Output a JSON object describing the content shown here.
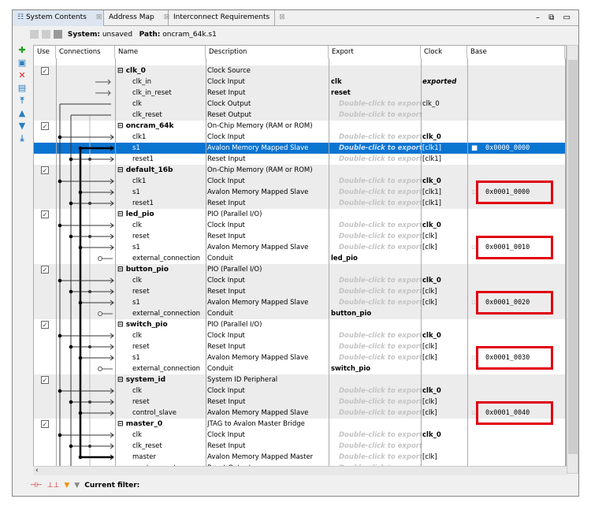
{
  "tabs": [
    {
      "label": "System Contents",
      "close": "⊠"
    },
    {
      "label": "Address Map",
      "close": "⊠"
    },
    {
      "label": "Interconnect Requirements",
      "close": "⊠"
    }
  ],
  "window_controls": "– ⧉ ▭",
  "pathbar": {
    "system_label": "System:",
    "system_value": "unsaved",
    "path_label": "Path:",
    "path_value": "oncram_64k.s1"
  },
  "columns": [
    "Use",
    "Connections",
    "Name",
    "Description",
    "Export",
    "Clock",
    "Base"
  ],
  "export_placeholder": "Double-click to export",
  "rows": [
    {
      "name": "clk_0",
      "desc": "Clock Source",
      "group": true,
      "checked": true
    },
    {
      "name": "clk_in",
      "desc": "Clock Input",
      "export": "clk",
      "clock": "exported"
    },
    {
      "name": "clk_in_reset",
      "desc": "Reset Input",
      "export": "reset"
    },
    {
      "name": "clk",
      "desc": "Clock Output",
      "dc": true,
      "clock": "clk_0"
    },
    {
      "name": "clk_reset",
      "desc": "Reset Output",
      "dc": true
    },
    {
      "name": "oncram_64k",
      "desc": "On-Chip Memory (RAM or ROM)",
      "group": true,
      "checked": true
    },
    {
      "name": "clk1",
      "desc": "Clock Input",
      "dc": true,
      "clock": "clk_0",
      "clockbold": true,
      "conn": "clk"
    },
    {
      "name": "s1",
      "desc": "Avalon Memory Mapped Slave",
      "dc": true,
      "clock": "[clk1]",
      "base": "0x0000_0000",
      "locked": true,
      "selected": true,
      "conn": "av"
    },
    {
      "name": "reset1",
      "desc": "Reset Input",
      "dc": true,
      "clock": "[clk1]",
      "conn": "rst"
    },
    {
      "name": "default_16b",
      "desc": "On-Chip Memory (RAM or ROM)",
      "group": true,
      "checked": true
    },
    {
      "name": "clk1",
      "desc": "Clock Input",
      "dc": true,
      "clock": "clk_0",
      "clockbold": true,
      "conn": "clk"
    },
    {
      "name": "s1",
      "desc": "Avalon Memory Mapped Slave",
      "dc": true,
      "clock": "[clk1]",
      "base": "0x0001_0000",
      "hl": true,
      "conn": "av"
    },
    {
      "name": "reset1",
      "desc": "Reset Input",
      "dc": true,
      "clock": "[clk1]",
      "conn": "rst"
    },
    {
      "name": "led_pio",
      "desc": "PIO (Parallel I/O)",
      "group": true,
      "checked": true
    },
    {
      "name": "clk",
      "desc": "Clock Input",
      "dc": true,
      "clock": "clk_0",
      "clockbold": true,
      "conn": "clk"
    },
    {
      "name": "reset",
      "desc": "Reset Input",
      "dc": true,
      "clock": "[clk]",
      "conn": "rst"
    },
    {
      "name": "s1",
      "desc": "Avalon Memory Mapped Slave",
      "dc": true,
      "clock": "[clk]",
      "base": "0x0001_0010",
      "hl": true,
      "conn": "av"
    },
    {
      "name": "external_connection",
      "desc": "Conduit",
      "export": "led_pio",
      "conn": "cd"
    },
    {
      "name": "button_pio",
      "desc": "PIO (Parallel I/O)",
      "group": true,
      "checked": true
    },
    {
      "name": "clk",
      "desc": "Clock Input",
      "dc": true,
      "clock": "clk_0",
      "clockbold": true,
      "conn": "clk"
    },
    {
      "name": "reset",
      "desc": "Reset Input",
      "dc": true,
      "clock": "[clk]",
      "conn": "rst"
    },
    {
      "name": "s1",
      "desc": "Avalon Memory Mapped Slave",
      "dc": true,
      "clock": "[clk]",
      "base": "0x0001_0020",
      "hl": true,
      "conn": "av"
    },
    {
      "name": "external_connection",
      "desc": "Conduit",
      "export": "button_pio",
      "conn": "cd"
    },
    {
      "name": "switch_pio",
      "desc": "PIO (Parallel I/O)",
      "group": true,
      "checked": true
    },
    {
      "name": "clk",
      "desc": "Clock Input",
      "dc": true,
      "clock": "clk_0",
      "clockbold": true,
      "conn": "clk"
    },
    {
      "name": "reset",
      "desc": "Reset Input",
      "dc": true,
      "clock": "[clk]",
      "conn": "rst"
    },
    {
      "name": "s1",
      "desc": "Avalon Memory Mapped Slave",
      "dc": true,
      "clock": "[clk]",
      "base": "0x0001_0030",
      "hl": true,
      "conn": "av"
    },
    {
      "name": "external_connection",
      "desc": "Conduit",
      "export": "switch_pio",
      "conn": "cd"
    },
    {
      "name": "system_id",
      "desc": "System ID Peripheral",
      "group": true,
      "checked": true
    },
    {
      "name": "clk",
      "desc": "Clock Input",
      "dc": true,
      "clock": "clk_0",
      "clockbold": true,
      "conn": "clk"
    },
    {
      "name": "reset",
      "desc": "Reset Input",
      "dc": true,
      "clock": "[clk]",
      "conn": "rst"
    },
    {
      "name": "control_slave",
      "desc": "Avalon Memory Mapped Slave",
      "dc": true,
      "clock": "[clk]",
      "base": "0x0001_0040",
      "hl": true,
      "conn": "av"
    },
    {
      "name": "master_0",
      "desc": "JTAG to Avalon Master Bridge",
      "group": true,
      "checked": true
    },
    {
      "name": "clk",
      "desc": "Clock Input",
      "dc": true,
      "clock": "clk_0",
      "clockbold": true,
      "conn": "clk"
    },
    {
      "name": "clk_reset",
      "desc": "Reset Input",
      "dc": true,
      "conn": "rst"
    },
    {
      "name": "master",
      "desc": "Avalon Memory Mapped Master",
      "dc": true,
      "clock": "[clk]",
      "conn": "master"
    },
    {
      "name": "master_reset",
      "desc": "Reset Output",
      "dc": true
    }
  ],
  "bottom": {
    "filter_label": "Current filter:"
  },
  "colors": {
    "selected": "#0a74d1",
    "highlight_box": "#e00010",
    "group_bg": "#ececec"
  }
}
